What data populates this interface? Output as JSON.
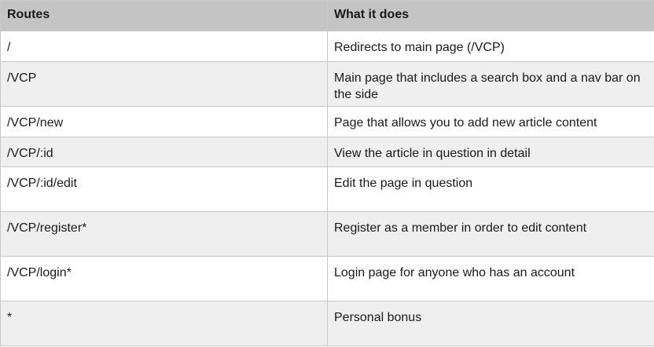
{
  "table": {
    "headers": [
      "Routes",
      "What it does"
    ],
    "rows": [
      {
        "route": "/",
        "description": "Redirects to main page (/VCP)"
      },
      {
        "route": "/VCP",
        "description": "Main page that includes a search box and a nav bar on the side"
      },
      {
        "route": "/VCP/new",
        "description": "Page that allows you to add new article content"
      },
      {
        "route": "/VCP/:id",
        "description": "View the article in question in detail"
      },
      {
        "route": "/VCP/:id/edit",
        "description": "Edit the page in question"
      },
      {
        "route": "/VCP/register*",
        "description": "Register as a member in order to edit content"
      },
      {
        "route": "/VCP/login*",
        "description": "Login page for anyone who has an account"
      },
      {
        "route": "*",
        "description": "Personal bonus"
      }
    ]
  }
}
